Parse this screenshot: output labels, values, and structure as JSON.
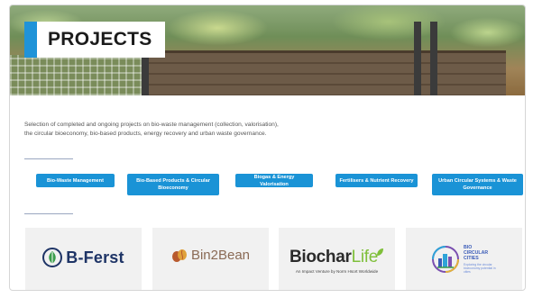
{
  "page": {
    "title": "PROJECTS"
  },
  "intro": {
    "text": "Selection of completed and ongoing projects on bio-waste management (collection, valorisation), the circular bioeconomy, bio-based products, energy recovery and urban waste governance."
  },
  "categories": [
    "Bio-Waste Management",
    "Bio-Based Products & Circular Bioeconomy",
    "Biogas & Energy Valorisation",
    "Fertilisers & Nutrient Recovery",
    "Urban Circular Systems & Waste Governance"
  ],
  "projects": [
    {
      "name": "B-Ferst",
      "icon": "leaf-circle-icon",
      "color": "#1e3466"
    },
    {
      "name": "Bin2Bean",
      "icon": "bean-icon",
      "color": "#8a6a55"
    },
    {
      "name_main": "Biochar",
      "name_accent": "Life",
      "subtitle": "An Impact Venture by Norm Hsort Worldwide",
      "icon": "leaf-icon"
    },
    {
      "title_lines": [
        "BIO",
        "CIRCULAR",
        "CITIES"
      ],
      "tagline": "Exploring the circular bioeconomy potential in cities",
      "icon": "city-circle-icon"
    }
  ],
  "colors": {
    "accent": "#1a93d6",
    "title_text": "#1b1b1b",
    "card_bg": "#f1f1f1"
  }
}
